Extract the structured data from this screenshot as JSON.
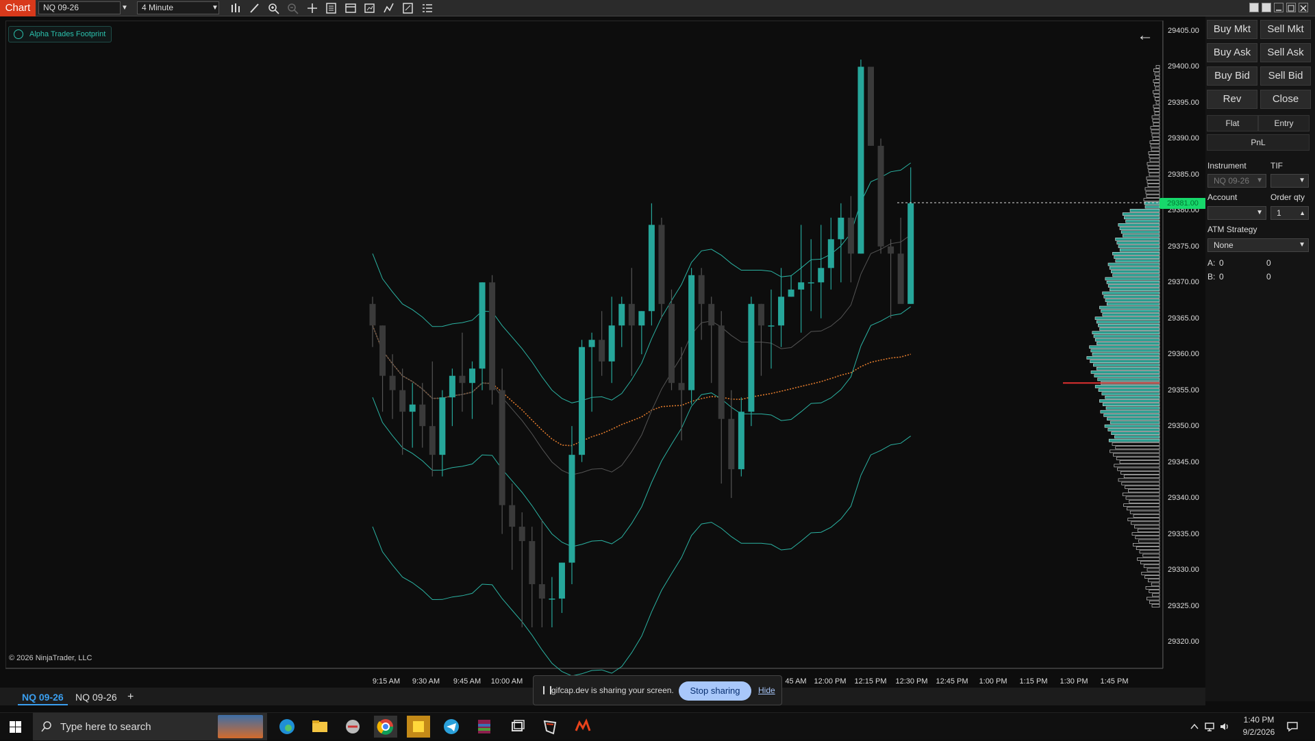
{
  "toolbar": {
    "chart_tab": "Chart",
    "instrument": "NQ 09-26",
    "interval": "4 Minute"
  },
  "chart": {
    "indicator_name": "Alpha Trades Footprint",
    "copyright": "© 2026 NinjaTrader, LLC",
    "last_price_label": "29381.00",
    "y_axis_labels": [
      "29405.00",
      "29400.00",
      "29395.00",
      "29390.00",
      "29385.00",
      "29380.00",
      "29375.00",
      "29370.00",
      "29365.00",
      "29360.00",
      "29355.00",
      "29350.00",
      "29345.00",
      "29340.00",
      "29335.00",
      "29330.00",
      "29325.00",
      "29320.00"
    ],
    "x_axis_labels": [
      "9:15 AM",
      "9:30 AM",
      "9:45 AM",
      "10:00 AM",
      "12:00 PM",
      "12:15 PM",
      "12:30 PM",
      "12:45 PM",
      "1:00 PM",
      "1:15 PM",
      "1:30 PM",
      "1:45 PM"
    ],
    "x_axis_partial": "45 AM",
    "colors": {
      "bull": "#26a69a",
      "bear": "#3a3a3a",
      "vwap": "#e07a2c",
      "band": "#2bb3a3",
      "profile": "#2a9d8f",
      "poc": "#e03030",
      "price_tag": "#17d86b"
    }
  },
  "chart_data": {
    "type": "candlestick",
    "title": "NQ 09-26",
    "interval": "4 Minute",
    "ylim": [
      29318,
      29407
    ],
    "candles": [
      [
        29367,
        29368,
        29361,
        29364
      ],
      [
        29364,
        29364,
        29352,
        29357
      ],
      [
        29357,
        29360,
        29351,
        29355
      ],
      [
        29355,
        29358,
        29346,
        29352
      ],
      [
        29352,
        29356,
        29347,
        29353
      ],
      [
        29353,
        29356,
        29347,
        29350
      ],
      [
        29350,
        29359,
        29343,
        29346
      ],
      [
        29346,
        29355,
        29343,
        29354
      ],
      [
        29354,
        29358,
        29350,
        29357
      ],
      [
        29357,
        29363,
        29352,
        29356
      ],
      [
        29356,
        29359,
        29351,
        29358
      ],
      [
        29358,
        29370,
        29355,
        29370
      ],
      [
        29370,
        29371,
        29353,
        29355
      ],
      [
        29355,
        29358,
        29335,
        29339
      ],
      [
        29339,
        29342,
        29330,
        29336
      ],
      [
        29336,
        29338,
        29322,
        29334
      ],
      [
        29334,
        29336,
        29322,
        29328
      ],
      [
        29328,
        29337,
        29322,
        29326
      ],
      [
        29326,
        29329,
        29322,
        29326
      ],
      [
        29326,
        29331,
        29324,
        29331
      ],
      [
        29331,
        29350,
        29328,
        29346
      ],
      [
        29346,
        29362,
        29345,
        29361
      ],
      [
        29361,
        29363,
        29352,
        29362
      ],
      [
        29362,
        29366,
        29357,
        29359
      ],
      [
        29359,
        29368,
        29356,
        29364
      ],
      [
        29364,
        29368,
        29361,
        29367
      ],
      [
        29367,
        29372,
        29357,
        29364
      ],
      [
        29364,
        29366,
        29360,
        29366
      ],
      [
        29366,
        29381,
        29364,
        29378
      ],
      [
        29378,
        29379,
        29365,
        29367
      ],
      [
        29367,
        29369,
        29355,
        29356
      ],
      [
        29356,
        29361,
        29348,
        29355
      ],
      [
        29355,
        29372,
        29353,
        29371
      ],
      [
        29371,
        29372,
        29362,
        29367
      ],
      [
        29367,
        29368,
        29356,
        29364
      ],
      [
        29364,
        29366,
        29342,
        29351
      ],
      [
        29351,
        29355,
        29340,
        29344
      ],
      [
        29344,
        29354,
        29343,
        29352
      ],
      [
        29352,
        29368,
        29350,
        29367
      ],
      [
        29367,
        29367,
        29357,
        29364
      ],
      [
        29364,
        29369,
        29358,
        29364
      ],
      [
        29364,
        29372,
        29361,
        29368
      ],
      [
        29368,
        29371,
        29368,
        29369
      ],
      [
        29369,
        29378,
        29363,
        29370
      ],
      [
        29370,
        29376,
        29366,
        29370
      ],
      [
        29370,
        29378,
        29365,
        29372
      ],
      [
        29372,
        29379,
        29369,
        29376
      ],
      [
        29376,
        29381,
        29370,
        29379
      ],
      [
        29379,
        29382,
        29370,
        29374
      ],
      [
        29374,
        29401,
        29374,
        29400
      ],
      [
        29400,
        29399,
        29389,
        29389
      ],
      [
        29389,
        29390,
        29374,
        29375
      ],
      [
        29375,
        29376,
        29365,
        29374
      ],
      [
        29374,
        29379,
        29368,
        29367
      ],
      [
        29367,
        29386,
        29367,
        29381
      ]
    ],
    "indicators": [
      "upper band",
      "middle band",
      "lower band",
      "VWAP",
      "volume profile"
    ]
  },
  "order_panel": {
    "buttons": [
      "Buy Mkt",
      "Sell Mkt",
      "Buy Ask",
      "Sell Ask",
      "Buy Bid",
      "Sell Bid",
      "Rev",
      "Close"
    ],
    "flat": "Flat",
    "entry": "Entry",
    "pnl": "PnL",
    "instrument_label": "Instrument",
    "instrument_value": "NQ 09-26",
    "tif_label": "TIF",
    "account_label": "Account",
    "order_qty_label": "Order qty",
    "order_qty_value": "1",
    "atm_label": "ATM Strategy",
    "atm_value": "None",
    "a_label": "A:",
    "a_value1": "0",
    "a_value2": "0",
    "b_label": "B:",
    "b_value1": "0",
    "b_value2": "0"
  },
  "bottom_tabs": [
    "NQ 09-26",
    "NQ 09-26"
  ],
  "add_tab": "+",
  "share_bar": {
    "message": "gifcap.dev is sharing your screen.",
    "stop": "Stop sharing",
    "hide": "Hide"
  },
  "taskbar": {
    "search_placeholder": "Type here to search",
    "time": "1:40 PM",
    "date": "9/2/2026"
  }
}
